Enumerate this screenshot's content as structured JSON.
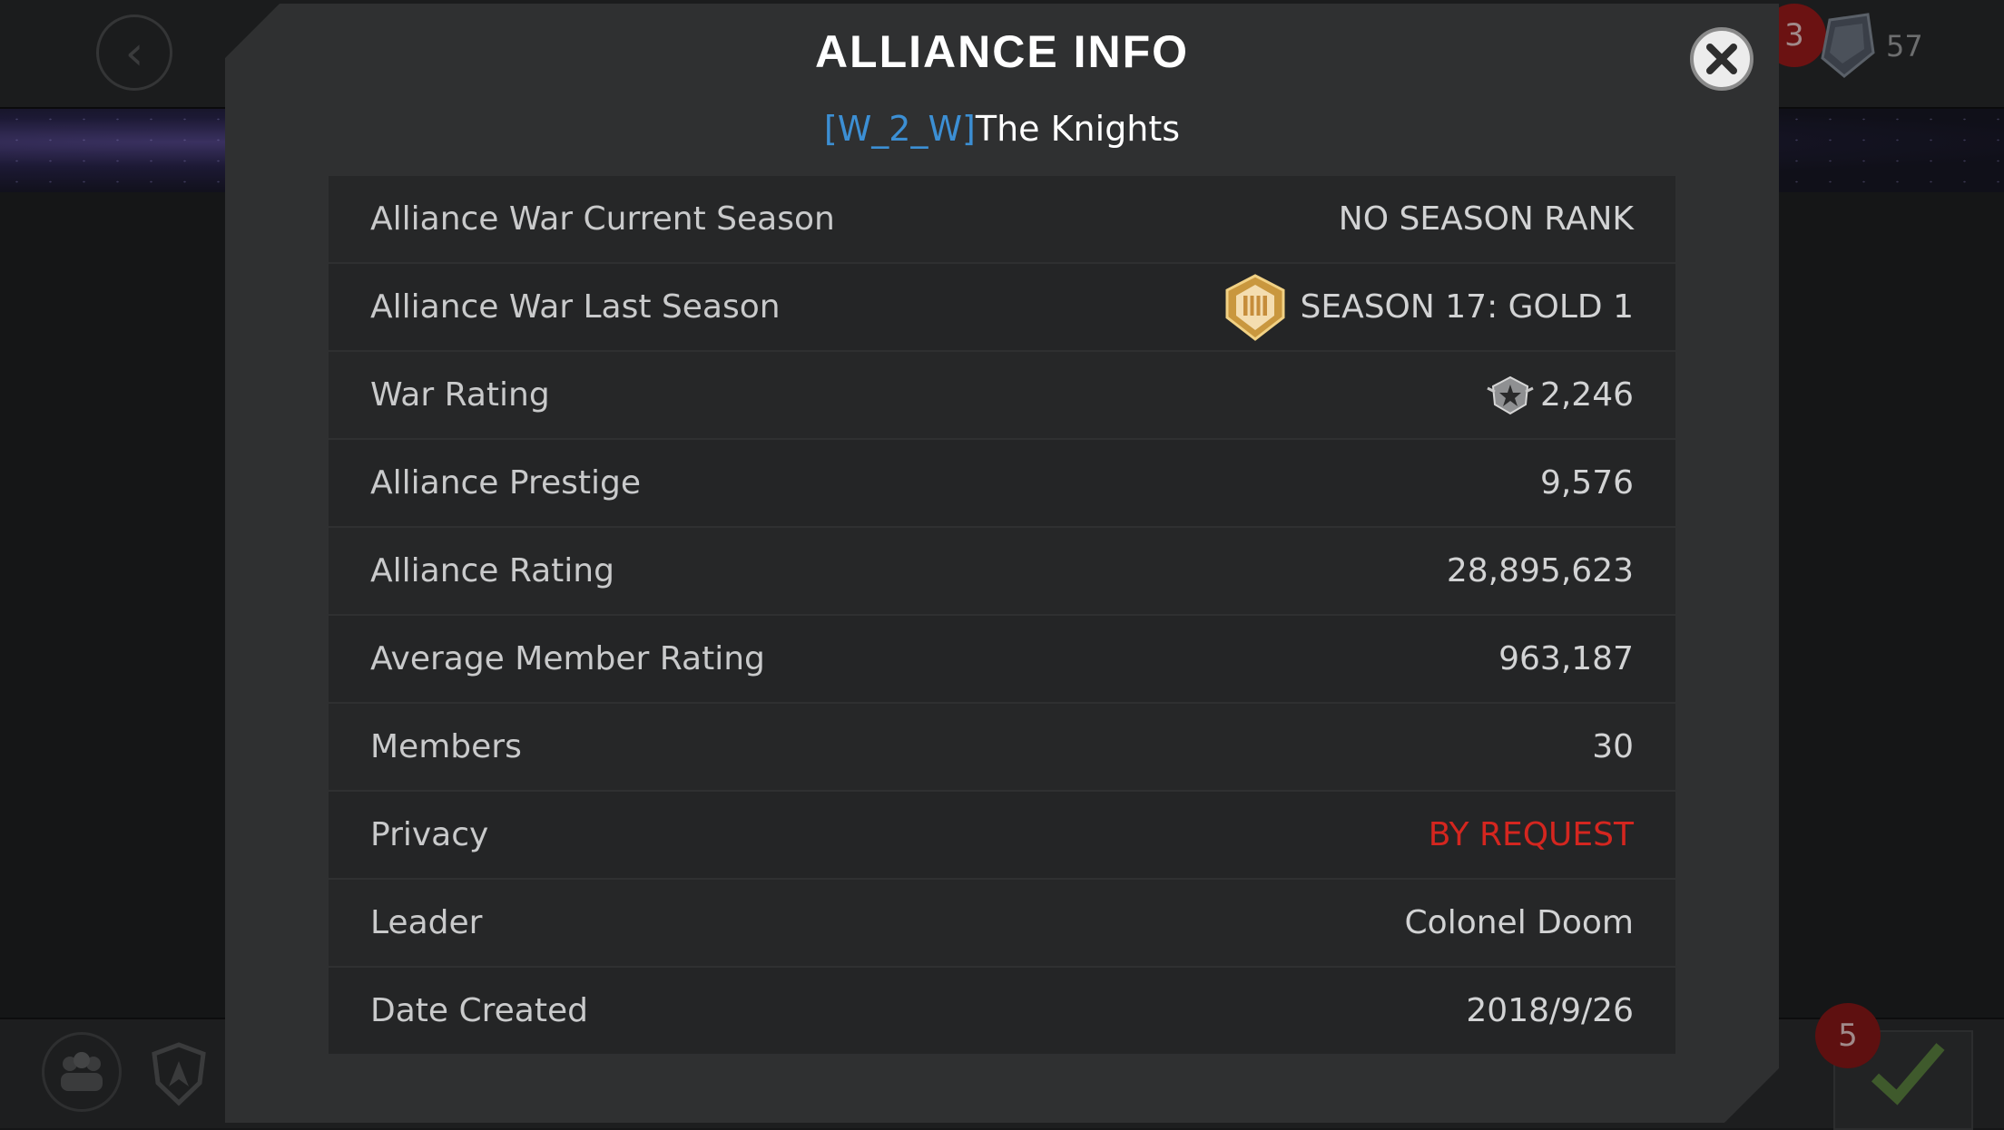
{
  "modal": {
    "title": "ALLIANCE INFO",
    "alliance_tag": "[W_2_W]",
    "alliance_name": "The Knights",
    "close_icon": "close-x-icon"
  },
  "rows": [
    {
      "label": "Alliance War Current Season",
      "value": "NO SEASON RANK"
    },
    {
      "label": "Alliance War Last Season",
      "value": "SEASON 17: GOLD 1",
      "icon": "gold-medal-icon"
    },
    {
      "label": "War Rating",
      "value": "2,246",
      "icon": "war-rating-icon"
    },
    {
      "label": "Alliance Prestige",
      "value": "9,576"
    },
    {
      "label": "Alliance Rating",
      "value": "28,895,623"
    },
    {
      "label": "Average Member Rating",
      "value": "963,187"
    },
    {
      "label": "Members",
      "value": "30"
    },
    {
      "label": "Privacy",
      "value": "BY REQUEST",
      "color": "#d4261f"
    },
    {
      "label": "Leader",
      "value": "Colonel Doom"
    },
    {
      "label": "Date Created",
      "value": "2018/9/26"
    }
  ],
  "background": {
    "notification_count_top": "3",
    "crystal_count": "57",
    "notification_count_bottom": "5"
  },
  "colors": {
    "tag": "#3c8fd4",
    "privacy": "#d4261f",
    "modal": "#2f3031"
  }
}
